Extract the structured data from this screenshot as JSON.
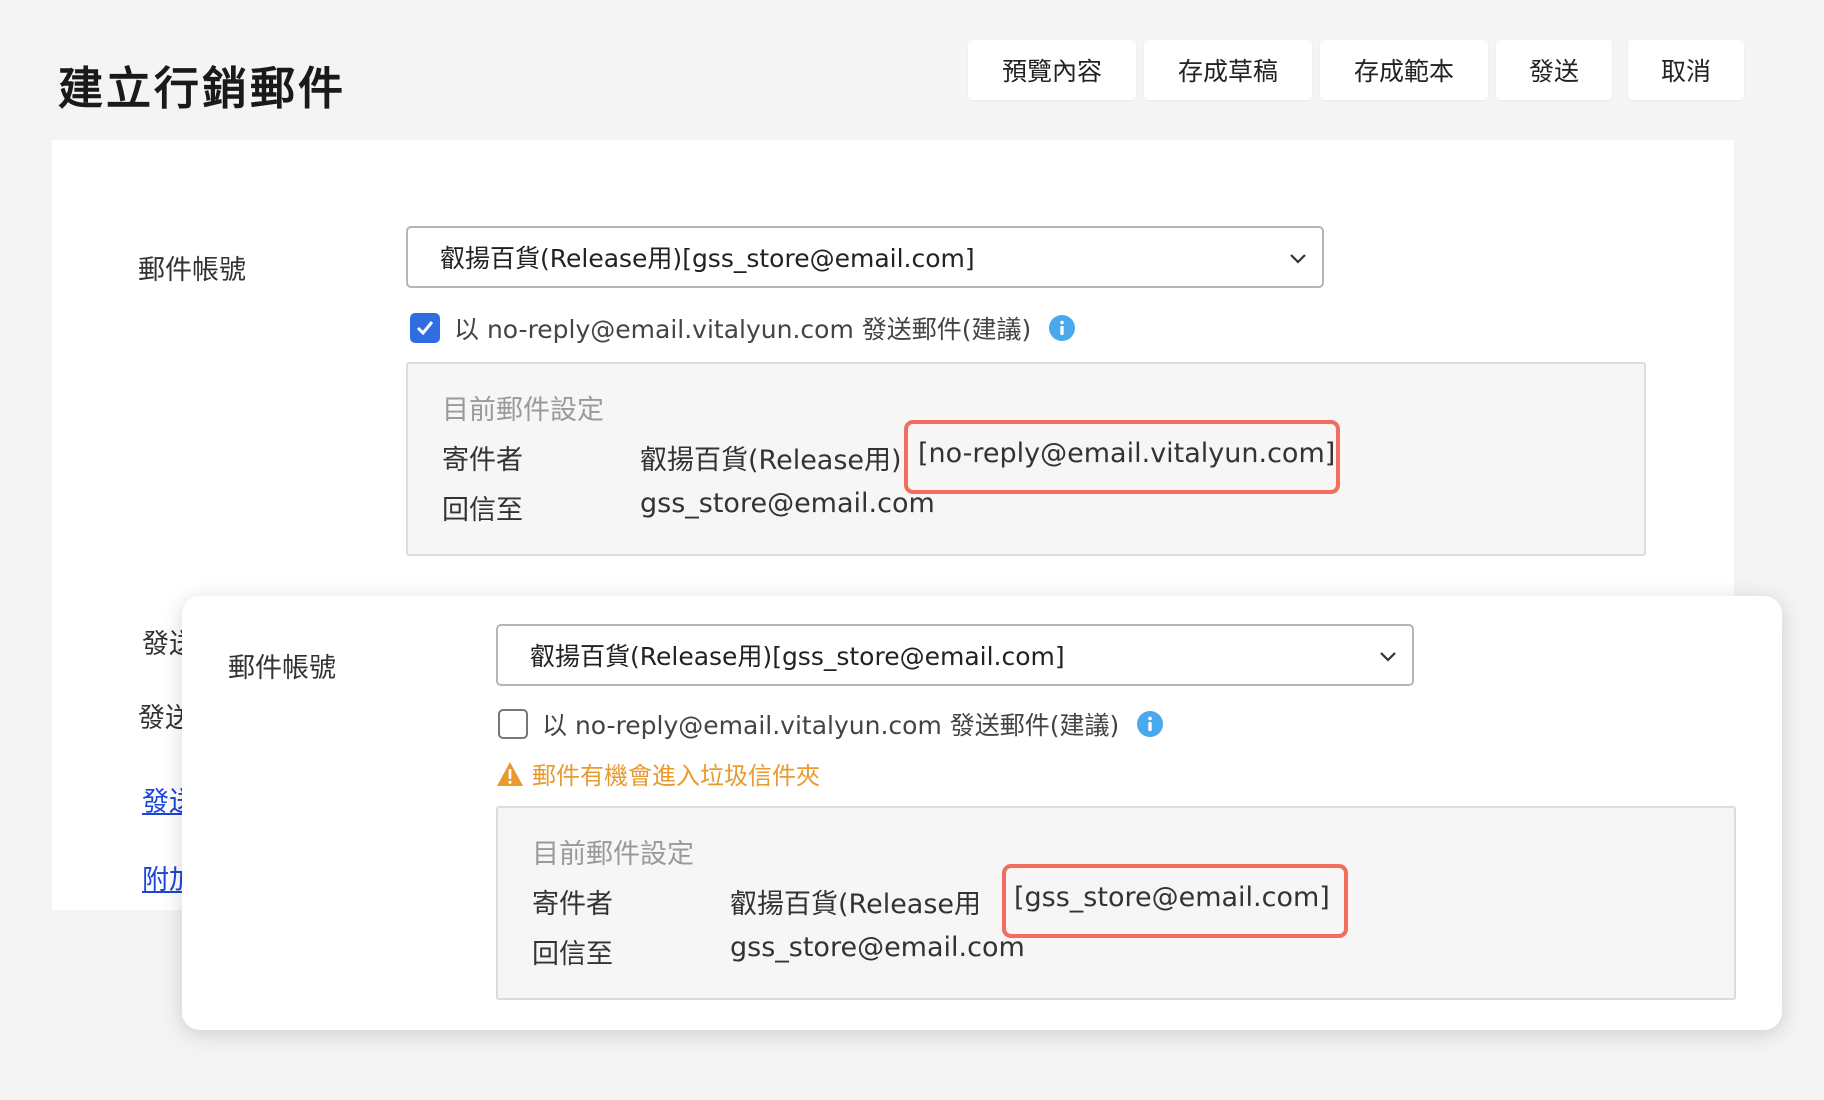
{
  "header": {
    "title": "建立行銷郵件",
    "buttons": {
      "preview": "預覽內容",
      "save_draft": "存成草稿",
      "save_template": "存成範本",
      "send": "發送",
      "cancel": "取消"
    }
  },
  "form": {
    "account_label": "郵件帳號",
    "account_value": "叡揚百貨(Release用)[gss_store@email.com]",
    "noreply_option": "以 no-reply@email.vitalyun.com 發送郵件(建議)",
    "partial_labels": [
      "發送",
      "發送",
      "發送",
      "附加"
    ]
  },
  "settings_checked": {
    "title": "目前郵件設定",
    "sender_label": "寄件者",
    "sender_name": "叡揚百貨(Release用)",
    "sender_address": "[no-reply@email.vitalyun.com]",
    "reply_label": "回信至",
    "reply_value": "gss_store@email.com"
  },
  "overlay": {
    "account_label": "郵件帳號",
    "account_value": "叡揚百貨(Release用)[gss_store@email.com]",
    "noreply_option": "以 no-reply@email.vitalyun.com 發送郵件(建議)",
    "warning": "郵件有機會進入垃圾信件夾",
    "settings": {
      "title": "目前郵件設定",
      "sender_label": "寄件者",
      "sender_name": "叡揚百貨(Release用",
      "sender_address": "[gss_store@email.com]",
      "reply_label": "回信至",
      "reply_value": "gss_store@email.com"
    }
  },
  "colors": {
    "checkbox_checked": "#2f6de1",
    "info": "#4aa8ec",
    "warning": "#e99a2f",
    "highlight": "#f26d5e",
    "link": "#1a45d8"
  },
  "icons": [
    "checkmark-icon",
    "info-icon",
    "warning-icon",
    "chevron-down-icon"
  ]
}
